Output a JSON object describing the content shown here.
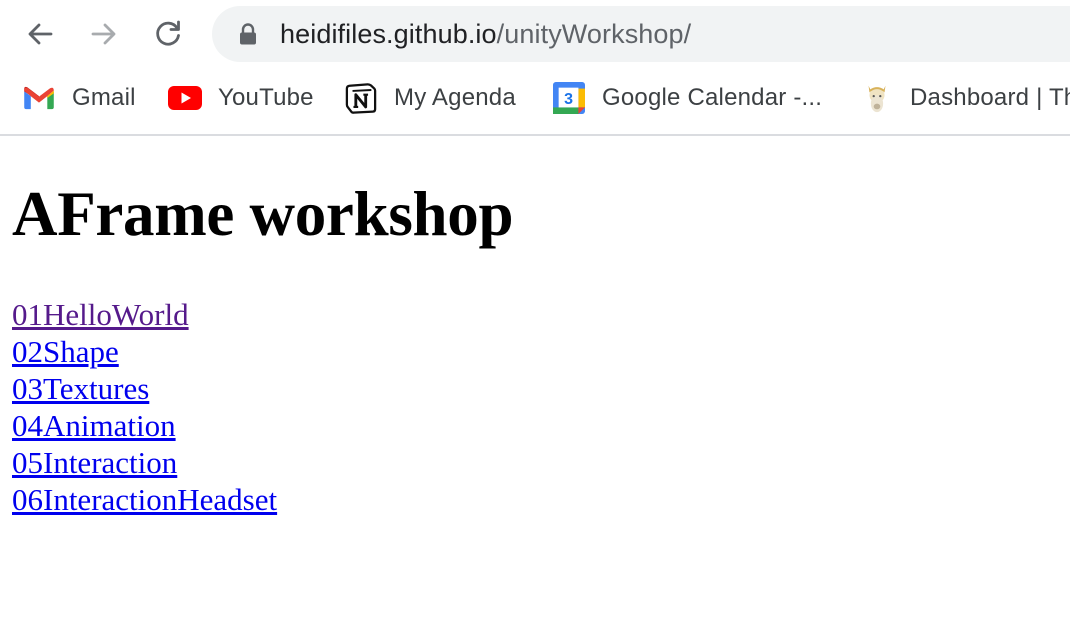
{
  "browser": {
    "url_host": "heidifiles.github.io",
    "url_path": "/unityWorkshop/",
    "nav": {
      "back_icon": "arrow-left",
      "forward_icon": "arrow-right",
      "reload_icon": "reload"
    },
    "bookmarks": [
      {
        "label": "Gmail",
        "icon": "gmail-icon"
      },
      {
        "label": "YouTube",
        "icon": "youtube-icon"
      },
      {
        "label": "My Agenda",
        "icon": "notion-icon"
      },
      {
        "label": "Google Calendar -...",
        "icon": "google-calendar-icon",
        "icon_text": "3"
      },
      {
        "label": "Dashboard | Th",
        "icon": "alpaca-icon"
      }
    ]
  },
  "page": {
    "title": "AFrame workshop",
    "links": [
      {
        "label": "01HelloWorld",
        "visited": true
      },
      {
        "label": "02Shape",
        "visited": false
      },
      {
        "label": "03Textures",
        "visited": false
      },
      {
        "label": "04Animation",
        "visited": false
      },
      {
        "label": "05Interaction",
        "visited": false
      },
      {
        "label": "06InteractionHeadset",
        "visited": false
      }
    ]
  },
  "colors": {
    "link": "#0000ee",
    "visited_link": "#551a8b",
    "omnibox_bg": "#f1f3f4"
  }
}
